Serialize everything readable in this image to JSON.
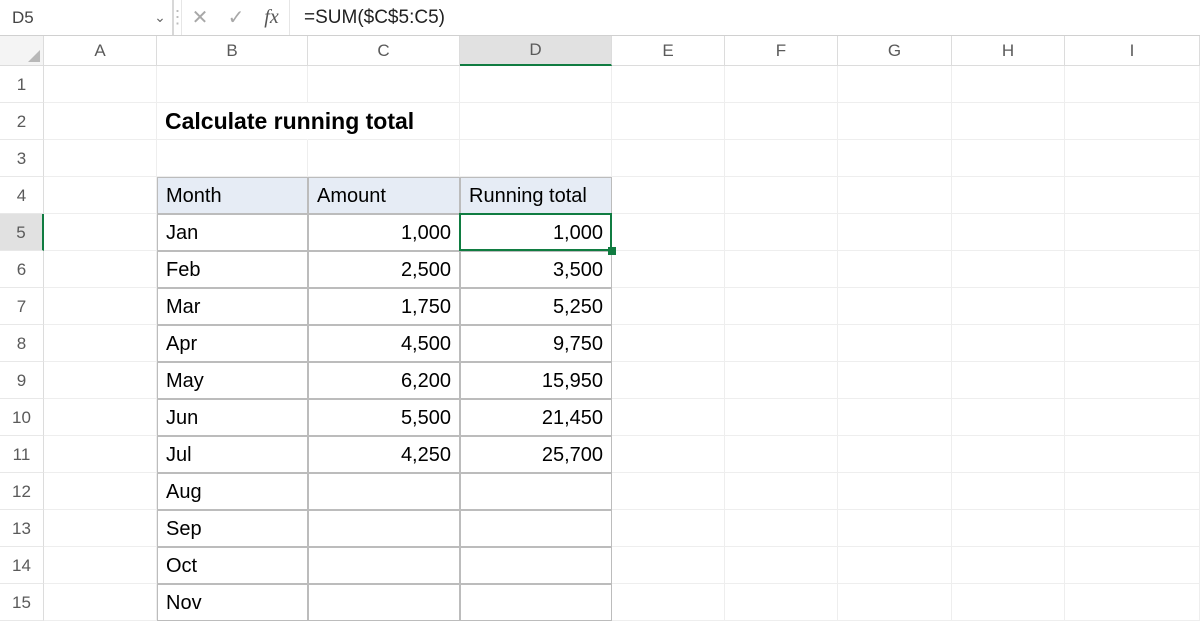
{
  "namebox": {
    "value": "D5"
  },
  "fx_label": "fx",
  "formula": "=SUM($C$5:C5)",
  "icons": {
    "chevron": "⌄",
    "vdots": "⋮",
    "cancel": "✕",
    "confirm": "✓"
  },
  "columns": [
    "A",
    "B",
    "C",
    "D",
    "E",
    "F",
    "G",
    "H",
    "I"
  ],
  "active_col": "D",
  "row_labels": [
    "1",
    "2",
    "3",
    "4",
    "5",
    "6",
    "7",
    "8",
    "9",
    "10",
    "11",
    "12",
    "13",
    "14",
    "15"
  ],
  "active_row": "5",
  "title_cell": "Calculate running total",
  "headers": {
    "month": "Month",
    "amount": "Amount",
    "running": "Running total"
  },
  "rows": [
    {
      "month": "Jan",
      "amount": "1,000",
      "running": "1,000"
    },
    {
      "month": "Feb",
      "amount": "2,500",
      "running": "3,500"
    },
    {
      "month": "Mar",
      "amount": "1,750",
      "running": "5,250"
    },
    {
      "month": "Apr",
      "amount": "4,500",
      "running": "9,750"
    },
    {
      "month": "May",
      "amount": "6,200",
      "running": "15,950"
    },
    {
      "month": "Jun",
      "amount": "5,500",
      "running": "21,450"
    },
    {
      "month": "Jul",
      "amount": "4,250",
      "running": "25,700"
    },
    {
      "month": "Aug",
      "amount": "",
      "running": ""
    },
    {
      "month": "Sep",
      "amount": "",
      "running": ""
    },
    {
      "month": "Oct",
      "amount": "",
      "running": ""
    },
    {
      "month": "Nov",
      "amount": "",
      "running": ""
    }
  ],
  "chart_data": {
    "type": "table",
    "title": "Calculate running total",
    "columns": [
      "Month",
      "Amount",
      "Running total"
    ],
    "records": [
      [
        "Jan",
        1000,
        1000
      ],
      [
        "Feb",
        2500,
        3500
      ],
      [
        "Mar",
        1750,
        5250
      ],
      [
        "Apr",
        4500,
        9750
      ],
      [
        "May",
        6200,
        15950
      ],
      [
        "Jun",
        5500,
        21450
      ],
      [
        "Jul",
        4250,
        25700
      ]
    ]
  }
}
